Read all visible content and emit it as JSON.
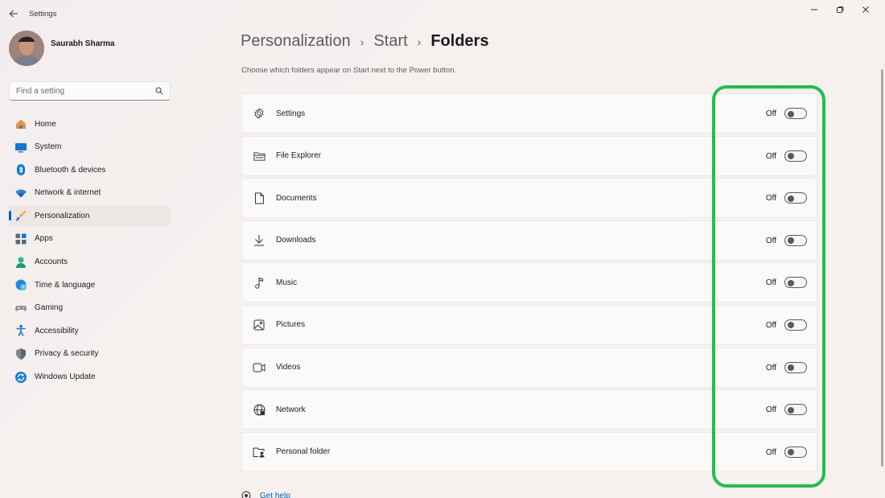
{
  "window": {
    "title": "Settings",
    "controls": [
      "minimize-icon",
      "restore-icon",
      "close-icon"
    ]
  },
  "profile": {
    "name": "Saurabh Sharma"
  },
  "search": {
    "placeholder": "Find a setting",
    "icon": "search-icon"
  },
  "sidebar": {
    "items": [
      {
        "label": "Home",
        "icon": "home-icon",
        "active": false
      },
      {
        "label": "System",
        "icon": "system-icon",
        "active": false
      },
      {
        "label": "Bluetooth & devices",
        "icon": "bluetooth-icon",
        "active": false
      },
      {
        "label": "Network & internet",
        "icon": "wifi-icon",
        "active": false
      },
      {
        "label": "Personalization",
        "icon": "brush-icon",
        "active": true
      },
      {
        "label": "Apps",
        "icon": "apps-icon",
        "active": false
      },
      {
        "label": "Accounts",
        "icon": "accounts-icon",
        "active": false
      },
      {
        "label": "Time & language",
        "icon": "globe-clock-icon",
        "active": false
      },
      {
        "label": "Gaming",
        "icon": "gamepad-icon",
        "active": false
      },
      {
        "label": "Accessibility",
        "icon": "accessibility-icon",
        "active": false
      },
      {
        "label": "Privacy & security",
        "icon": "shield-icon",
        "active": false
      },
      {
        "label": "Windows Update",
        "icon": "update-icon",
        "active": false
      }
    ]
  },
  "breadcrumb": {
    "items": [
      "Personalization",
      "Start",
      "Folders"
    ],
    "separator": "›"
  },
  "main": {
    "description": "Choose which folders appear on Start next to the Power button.",
    "rows": [
      {
        "label": "Settings",
        "icon": "gear-icon",
        "state": "Off"
      },
      {
        "label": "File Explorer",
        "icon": "folder-icon",
        "state": "Off"
      },
      {
        "label": "Documents",
        "icon": "document-icon",
        "state": "Off"
      },
      {
        "label": "Downloads",
        "icon": "download-icon",
        "state": "Off"
      },
      {
        "label": "Music",
        "icon": "music-note-icon",
        "state": "Off"
      },
      {
        "label": "Pictures",
        "icon": "picture-icon",
        "state": "Off"
      },
      {
        "label": "Videos",
        "icon": "video-icon",
        "state": "Off"
      },
      {
        "label": "Network",
        "icon": "network-globe-icon",
        "state": "Off"
      },
      {
        "label": "Personal folder",
        "icon": "personal-folder-icon",
        "state": "Off"
      }
    ],
    "help_link": "Get help"
  },
  "colors": {
    "accent": "#005fb8",
    "highlight_outline": "#1fbf4f"
  }
}
